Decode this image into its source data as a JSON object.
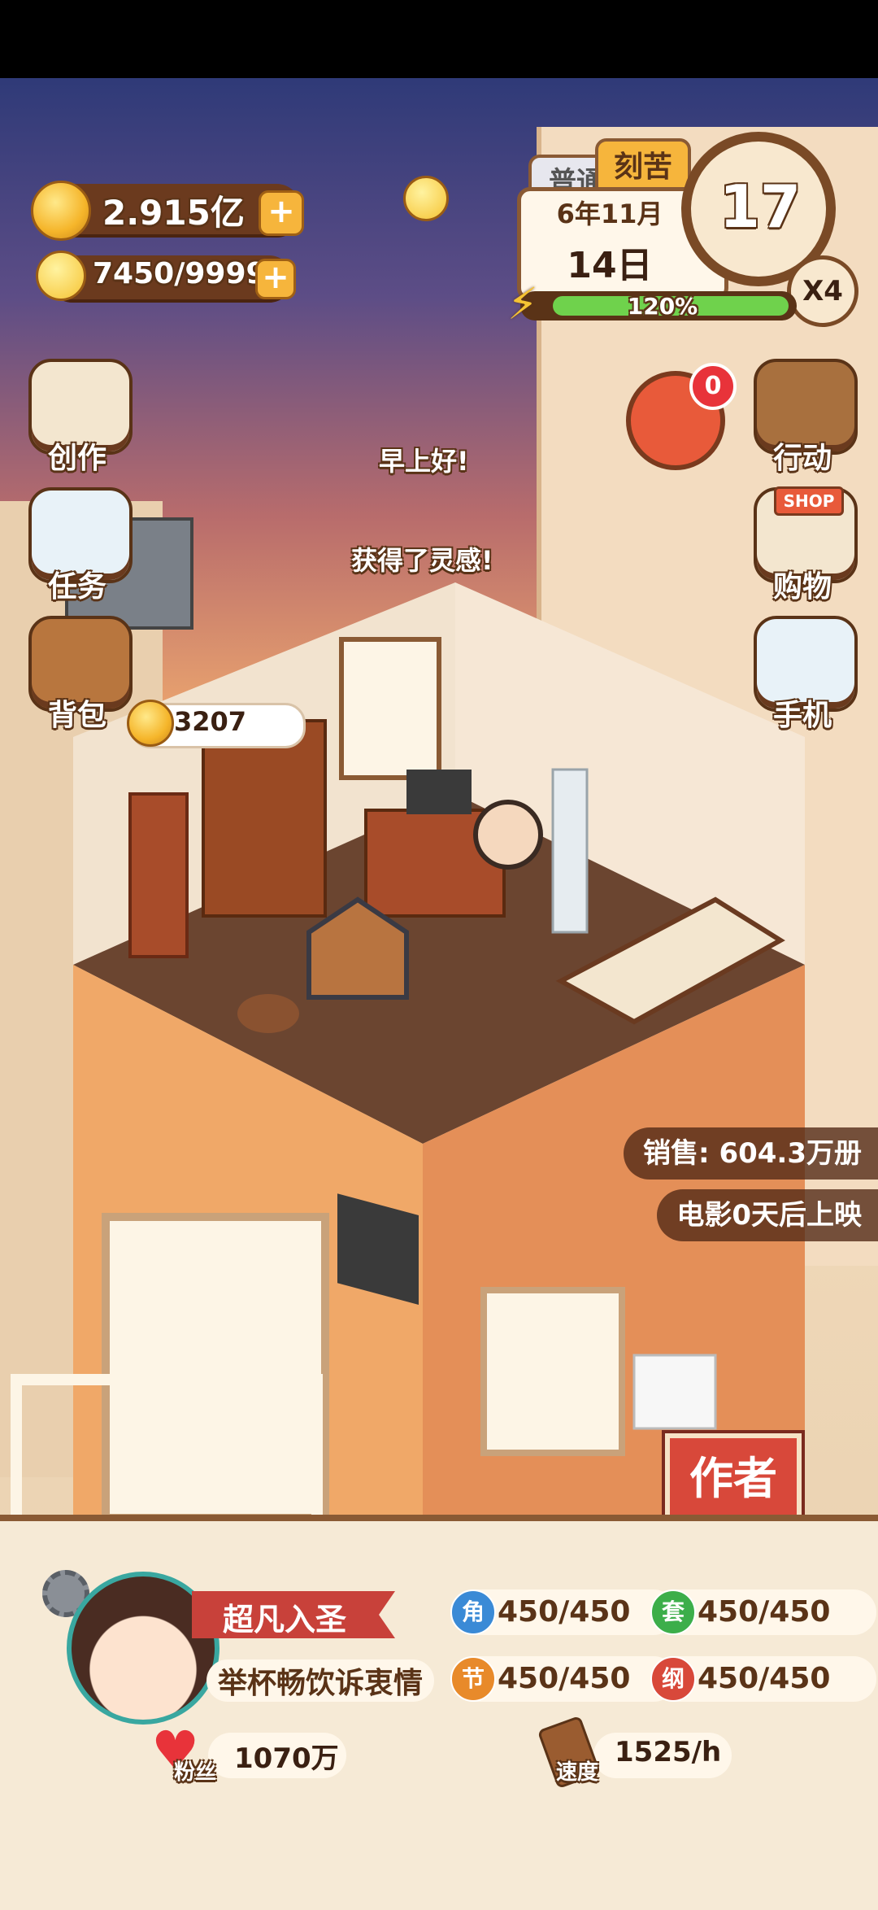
{
  "currency": {
    "gold": "2.915亿",
    "inspiration": "7450/9999"
  },
  "time": {
    "mode_tab_normal": "普通",
    "mode_tab_hard": "刻苦",
    "year_month": "6年11月",
    "day": "14日",
    "hour": "17",
    "speed": "X4",
    "energy": "120%",
    "energy_level": 1.0
  },
  "left_menu": [
    {
      "label": "创作",
      "icon": "book-icon"
    },
    {
      "label": "任务",
      "icon": "checklist-icon"
    },
    {
      "label": "背包",
      "icon": "bag-icon"
    }
  ],
  "right_menu": [
    {
      "label": "行动",
      "icon": "door-icon"
    },
    {
      "label": "购物",
      "icon": "shop-icon"
    },
    {
      "label": "手机",
      "icon": "phone-icon"
    }
  ],
  "shop_sign": "SHOP",
  "notify_count": "0",
  "messages": {
    "greeting": "早上好!",
    "inspiration": "获得了灵感!"
  },
  "coin_bubble": "3207",
  "sales": "销售: 604.3万册",
  "movie": "电影0天后上映",
  "author_button": "作者",
  "profile": {
    "title": "超凡入圣",
    "motto": "举杯畅饮诉衷情",
    "fans_label": "粉丝",
    "fans": "1070万",
    "speed_label": "速度",
    "speed": "1525/h"
  },
  "stats": [
    {
      "badge": "角",
      "value": "450/450",
      "color": "#3a8ad6"
    },
    {
      "badge": "套",
      "value": "450/450",
      "color": "#3cae4a"
    },
    {
      "badge": "节",
      "value": "450/450",
      "color": "#e88a2a"
    },
    {
      "badge": "纲",
      "value": "450/450",
      "color": "#d8483a"
    }
  ]
}
